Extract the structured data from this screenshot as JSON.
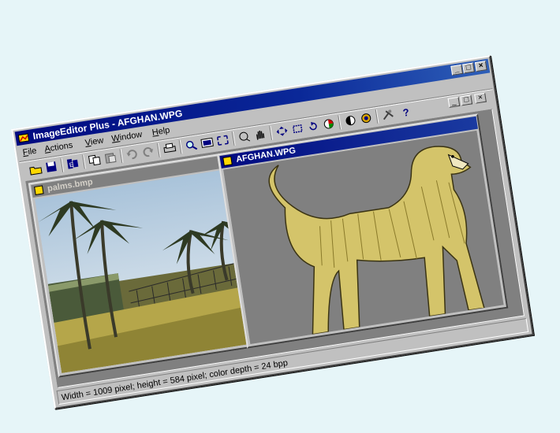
{
  "window": {
    "title": "ImageEditor Plus - AFGHAN.WPG",
    "controls": {
      "minimize": "_",
      "maximize": "□",
      "close": "×"
    }
  },
  "menubar": {
    "items": [
      {
        "label": "File"
      },
      {
        "label": "Actions"
      },
      {
        "label": "View"
      },
      {
        "label": "Window"
      },
      {
        "label": "Help"
      }
    ]
  },
  "toolbar": {
    "buttons": [
      {
        "icon": "open-folder-icon"
      },
      {
        "icon": "save-icon"
      },
      {
        "icon": "image-properties-icon"
      },
      {
        "icon": "copy-icon"
      },
      {
        "icon": "paste-icon"
      },
      {
        "icon": "undo-icon"
      },
      {
        "icon": "redo-icon"
      },
      {
        "icon": "print-icon"
      },
      {
        "icon": "zoom-icon"
      },
      {
        "icon": "fit-window-icon"
      },
      {
        "icon": "fullscreen-icon"
      },
      {
        "icon": "select-icon"
      },
      {
        "icon": "hand-pan-icon"
      },
      {
        "icon": "move-icon"
      },
      {
        "icon": "crop-icon"
      },
      {
        "icon": "rotate-icon"
      },
      {
        "icon": "color-wheel-icon"
      },
      {
        "icon": "contrast-icon"
      },
      {
        "icon": "color-balance-icon"
      },
      {
        "icon": "tools-icon"
      },
      {
        "icon": "help-icon"
      }
    ]
  },
  "documents": [
    {
      "title": "palms.bmp",
      "active": false
    },
    {
      "title": "AFGHAN.WPG",
      "active": true
    }
  ],
  "status": {
    "text": "Width = 1009 pixel; height = 584 pixel; color depth = 24 bpp"
  },
  "colors": {
    "title_active": "#000a80",
    "title_inactive": "#808080",
    "chrome": "#c0c0c0",
    "desktop": "#e6f5f8"
  }
}
